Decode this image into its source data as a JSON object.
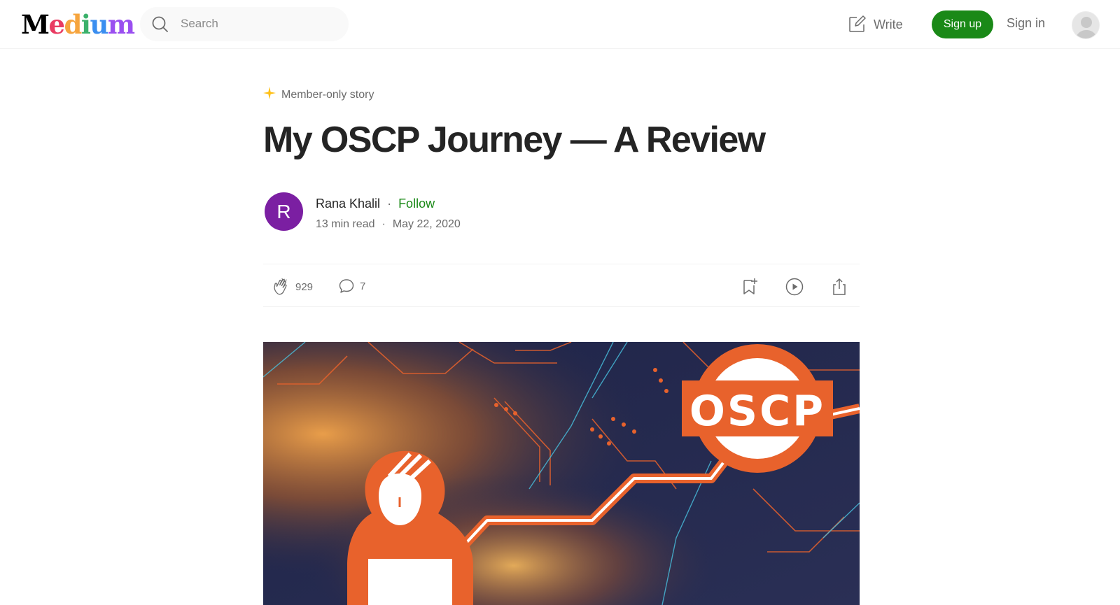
{
  "header": {
    "logo_text": "Medium",
    "logo_letters": [
      "M",
      "e",
      "d",
      "i",
      "u",
      "m"
    ],
    "logo_colors": [
      "#000000",
      "#e93b62",
      "#f6a43d",
      "#3bb16b",
      "#3a8ef0",
      "#9a4ff0"
    ],
    "search_placeholder": "Search",
    "search_icon": "search-icon",
    "write_label": "Write",
    "write_icon": "write-icon",
    "signup_label": "Sign up",
    "signin_label": "Sign in",
    "avatar_icon": "user-avatar-icon"
  },
  "article": {
    "badge": "Member-only story",
    "badge_icon": "star-icon",
    "title": "My OSCP Journey — A Review",
    "author": {
      "initial": "R",
      "name": "Rana Khalil",
      "follow_label": "Follow",
      "separator": "·"
    },
    "read_time": "13 min read",
    "meta_separator": "·",
    "date": "May 22, 2020"
  },
  "actions": {
    "claps": "929",
    "comments": "7",
    "icons": [
      "clap-icon",
      "comment-icon",
      "bookmark-icon",
      "play-icon",
      "share-icon"
    ]
  },
  "hero": {
    "badge_text": "OSCP"
  },
  "colors": {
    "accent_green": "#1a8917",
    "text_primary": "#242424",
    "text_secondary": "#6b6b6b",
    "avatar_purple": "#7b1fa2",
    "oscp_orange": "#e8622c"
  }
}
